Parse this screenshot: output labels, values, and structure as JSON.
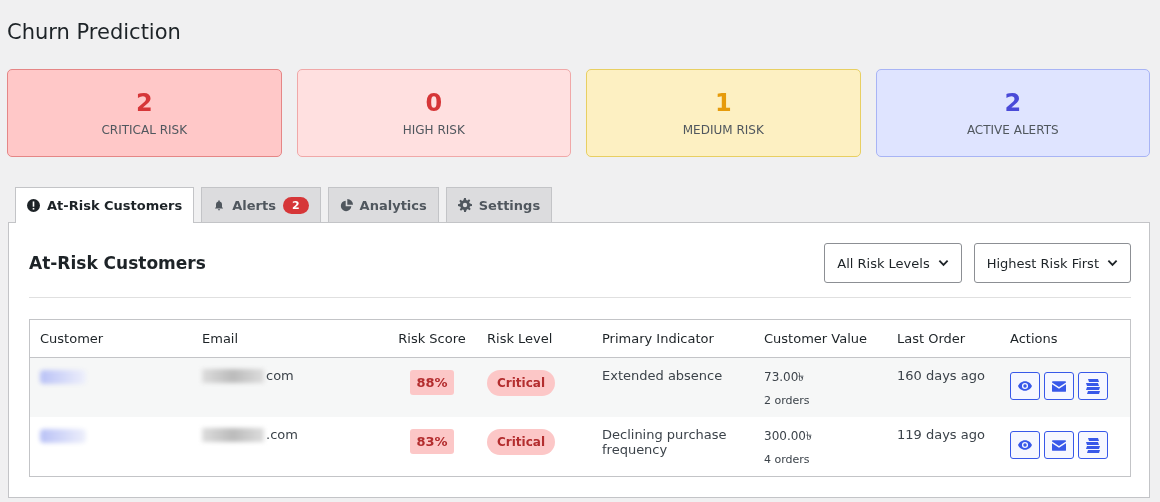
{
  "page": {
    "title": "Churn Prediction"
  },
  "stats": [
    {
      "kind": "critical",
      "value": "2",
      "label": "CRITICAL RISK"
    },
    {
      "kind": "high",
      "value": "0",
      "label": "HIGH RISK"
    },
    {
      "kind": "medium",
      "value": "1",
      "label": "MEDIUM RISK"
    },
    {
      "kind": "alerts",
      "value": "2",
      "label": "ACTIVE ALERTS"
    }
  ],
  "tabs": [
    {
      "kind": "risk",
      "label": "At-Risk Customers",
      "selected": true
    },
    {
      "kind": "alerts",
      "label": "Alerts",
      "badge": "2",
      "selected": false
    },
    {
      "kind": "analytics",
      "label": "Analytics",
      "selected": false
    },
    {
      "kind": "settings",
      "label": "Settings",
      "selected": false
    }
  ],
  "panel": {
    "title": "At-Risk Customers",
    "filters": [
      {
        "value": "All Risk Levels"
      },
      {
        "value": "Highest Risk First"
      }
    ]
  },
  "table": {
    "columns": [
      "Customer",
      "Email",
      "Risk Score",
      "Risk Level",
      "Primary Indicator",
      "Customer Value",
      "Last Order",
      "Actions"
    ],
    "rows": [
      {
        "email_domain": "com",
        "risk_score": "88%",
        "risk_level": "Critical",
        "indicator": "Extended absence",
        "value": "73.00৳",
        "orders": "2 orders",
        "last_order": "160 days ago"
      },
      {
        "email_domain": ".com",
        "risk_score": "83%",
        "risk_level": "Critical",
        "indicator": "Declining purchase frequency",
        "value": "300.00৳",
        "orders": "4 orders",
        "last_order": "119 days ago"
      }
    ]
  }
}
